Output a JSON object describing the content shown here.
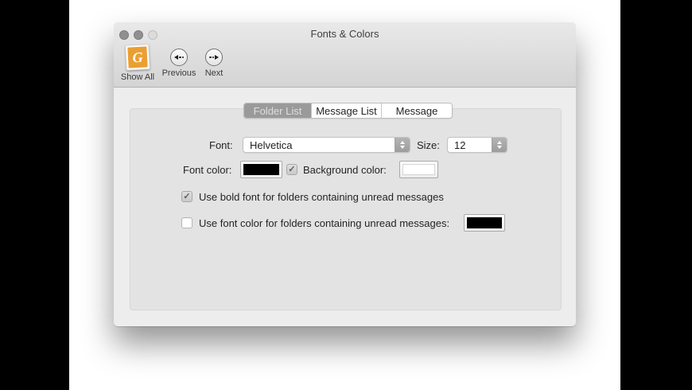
{
  "window": {
    "title": "Fonts & Colors",
    "toolbar": {
      "show_all_label": "Show All",
      "previous_label": "Previous",
      "next_label": "Next",
      "show_all_icon_letter": "G"
    },
    "tabs": [
      {
        "label": "Folder List",
        "selected": true
      },
      {
        "label": "Message List",
        "selected": false
      },
      {
        "label": "Message",
        "selected": false
      }
    ],
    "form": {
      "font_label": "Font:",
      "font_value": "Helvetica",
      "size_label": "Size:",
      "size_value": "12",
      "font_color_label": "Font color:",
      "font_color_value": "#000000",
      "background_color_label": "Background color:",
      "background_color_checked": true,
      "background_color_value": "#ffffff",
      "bold_checkbox_label": "Use bold font for folders containing unread messages",
      "bold_checkbox_checked": true,
      "unread_color_checkbox_label": "Use font color for folders containing unread messages:",
      "unread_color_checkbox_checked": false,
      "unread_color_value": "#000000",
      "checkmark_glyph": "✓"
    },
    "colors": {
      "selected_tab_bg": "#9a9a9a",
      "header_gradient_top": "#e9e9e9",
      "header_gradient_bottom": "#d4d4d4",
      "panel_bg": "#e3e3e3",
      "show_all_icon_orange": "#eb9f31"
    }
  }
}
